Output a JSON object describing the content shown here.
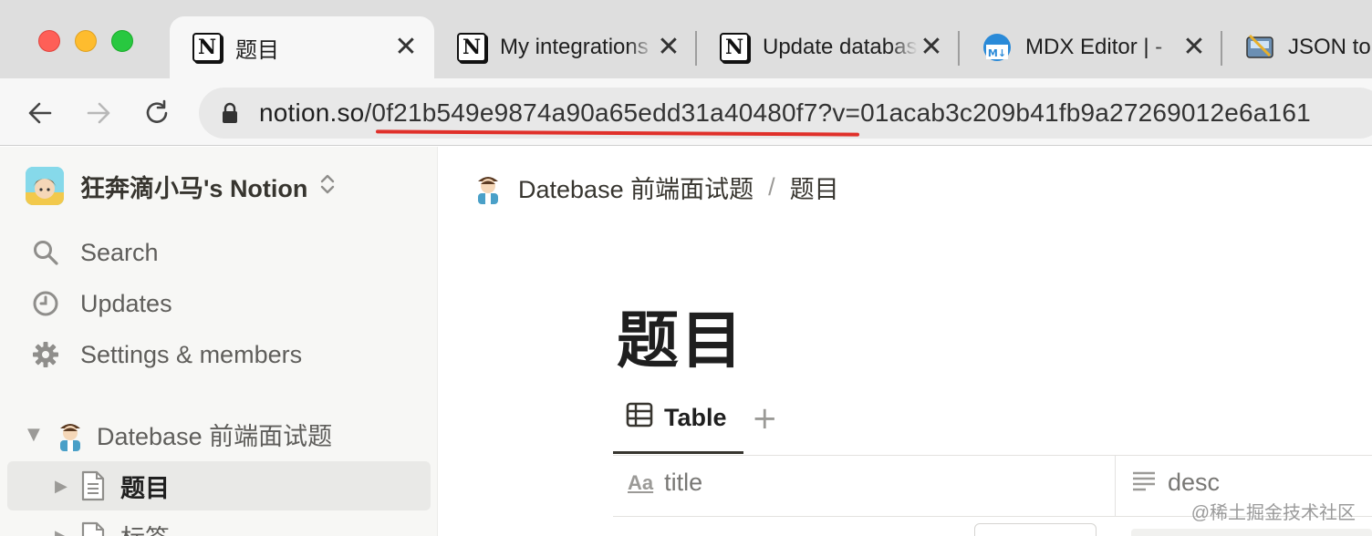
{
  "browser": {
    "tabs": [
      {
        "title": "题目",
        "favicon": "notion-icon",
        "active": true
      },
      {
        "title": "My integrations",
        "favicon": "notion-icon",
        "active": false
      },
      {
        "title": "Update database",
        "favicon": "notion-icon",
        "active": false
      },
      {
        "title": "MDX Editor | -",
        "favicon": "mdx-editor-icon",
        "active": false
      },
      {
        "title": "JSON to",
        "favicon": "json-tool-icon",
        "active": false
      }
    ],
    "close_glyph": "✕",
    "url_domain": "notion.so",
    "url_path": "/0f21b549e9874a90a65edd31a40480f7?v=01acab3c209b41fb9a27269012e6a161"
  },
  "sidebar": {
    "workspace_name": "狂奔滴小马's Notion",
    "items": [
      {
        "label": "Search",
        "icon": "search-icon"
      },
      {
        "label": "Updates",
        "icon": "clock-icon"
      },
      {
        "label": "Settings & members",
        "icon": "gear-icon"
      }
    ],
    "tree": [
      {
        "label": "Datebase 前端面试题",
        "icon": "avatar-emoji",
        "expanded": true
      },
      {
        "label": "题目",
        "icon": "page-icon",
        "selected": true
      },
      {
        "label": "标签",
        "icon": "page-icon",
        "selected": false
      }
    ]
  },
  "main": {
    "breadcrumb": [
      "Datebase 前端面试题",
      "题目"
    ],
    "breadcrumb_sep": "/",
    "title": "题目",
    "view_tab": "Table",
    "add_view": "+",
    "columns": [
      {
        "label": "title",
        "icon": "Aa"
      },
      {
        "label": "desc",
        "icon": "text-lines-icon"
      }
    ]
  },
  "watermark": "@稀土掘金技术社区",
  "colors": {
    "traffic_red": "#fe5f57",
    "traffic_yellow": "#febc2e",
    "traffic_green": "#28c840",
    "url_underline": "#e0302a",
    "sidebar_bg": "#f7f7f5"
  }
}
